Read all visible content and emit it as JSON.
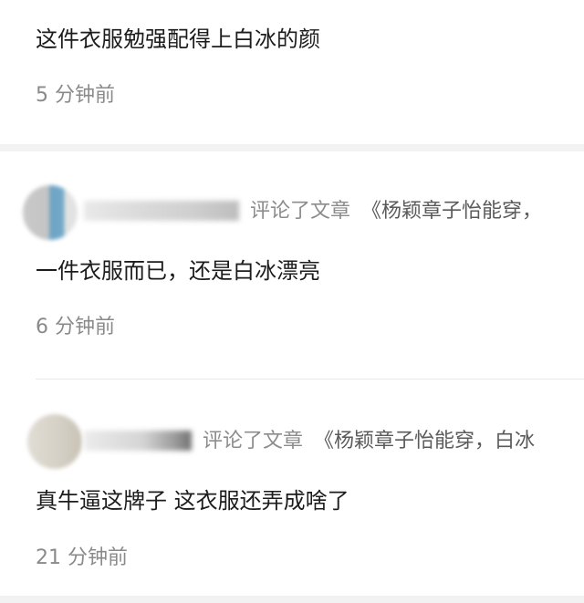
{
  "comments": [
    {
      "text": "这件衣服勉强配得上白冰的颜",
      "time": "5 分钟前"
    },
    {
      "action": "评论了文章",
      "article": "《杨颖章子怡能穿，",
      "text": "一件衣服而已，还是白冰漂亮",
      "time": "6 分钟前"
    },
    {
      "action": "评论了文章",
      "article": "《杨颖章子怡能穿，白冰",
      "text": "真牛逼这牌子 这衣服还弄成啥了",
      "time": "21 分钟前"
    }
  ]
}
